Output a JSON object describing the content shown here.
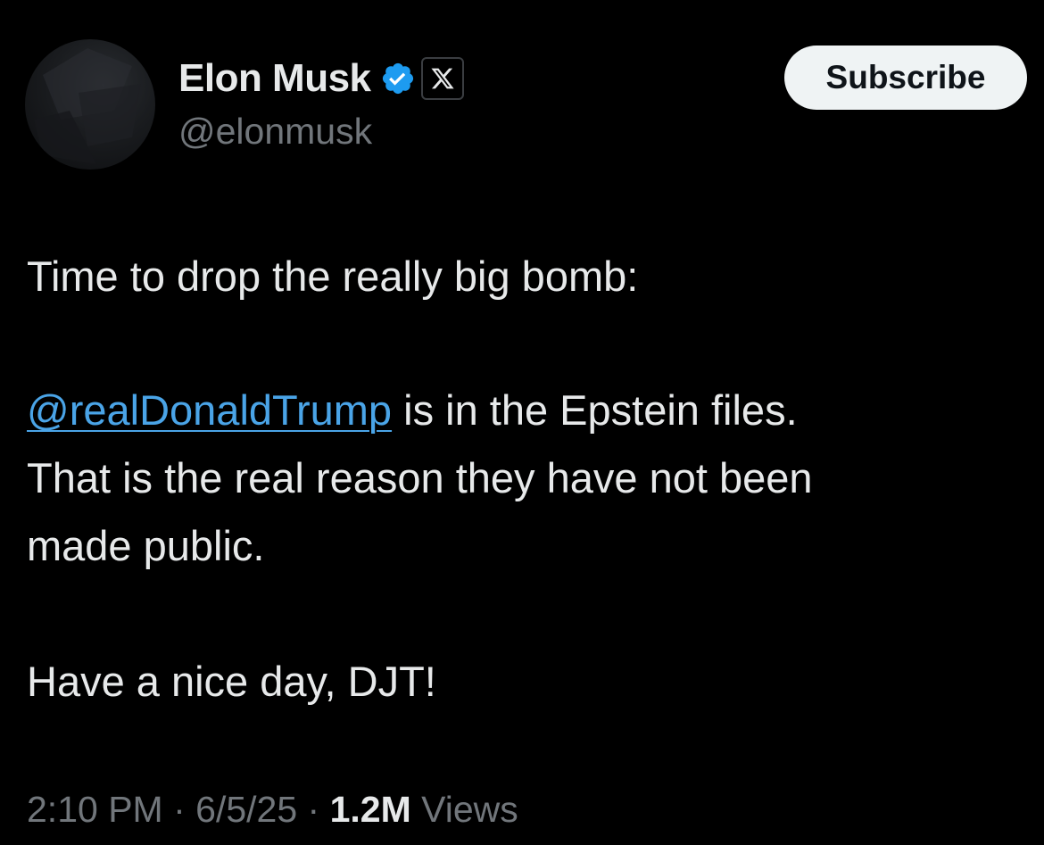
{
  "author": {
    "display_name": "Elon Musk",
    "handle": "@elonmusk",
    "verified_icon": "verified-badge-icon",
    "affiliation_icon": "x-logo-icon"
  },
  "header": {
    "subscribe_label": "Subscribe"
  },
  "tweet": {
    "line1": "Time to drop the really big bomb:",
    "mention": "@realDonaldTrump",
    "line2_rest": " is in the Epstein files.",
    "line3": "That is the real reason they have not been",
    "line4": "made public.",
    "line5": "Have a nice day, DJT!"
  },
  "meta": {
    "time": "2:10 PM",
    "separator": " · ",
    "date": "6/5/25",
    "views_count": "1.2M",
    "views_label": "Views"
  },
  "colors": {
    "background": "#000000",
    "text_primary": "#e7e9ea",
    "text_secondary": "#71767b",
    "link": "#4aa4e7",
    "verified_blue": "#1d9bf0",
    "button_bg": "#eff3f4"
  }
}
